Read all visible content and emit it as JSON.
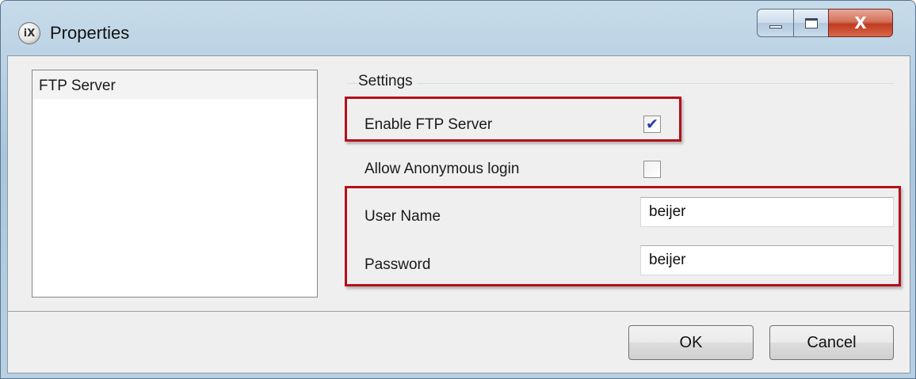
{
  "window": {
    "title": "Properties",
    "app_icon_text": "iX",
    "close_glyph": "X"
  },
  "nav": {
    "items": [
      {
        "label": "FTP Server",
        "selected": true
      }
    ]
  },
  "settings": {
    "group_label": "Settings",
    "enable_ftp": {
      "label": "Enable FTP Server",
      "checked": true
    },
    "allow_anonymous": {
      "label": "Allow Anonymous login",
      "checked": false
    },
    "user_name": {
      "label": "User Name",
      "value": "beijer"
    },
    "password": {
      "label": "Password",
      "value": "beijer"
    }
  },
  "buttons": {
    "ok": "OK",
    "cancel": "Cancel"
  },
  "colors": {
    "highlight": "#b3101c",
    "checkmark": "#2a3bb0",
    "close_button": "#c8452b"
  },
  "icons": {
    "minimize": "minimize-icon",
    "maximize": "maximize-icon",
    "close": "close-icon",
    "check": "checkmark-icon"
  }
}
